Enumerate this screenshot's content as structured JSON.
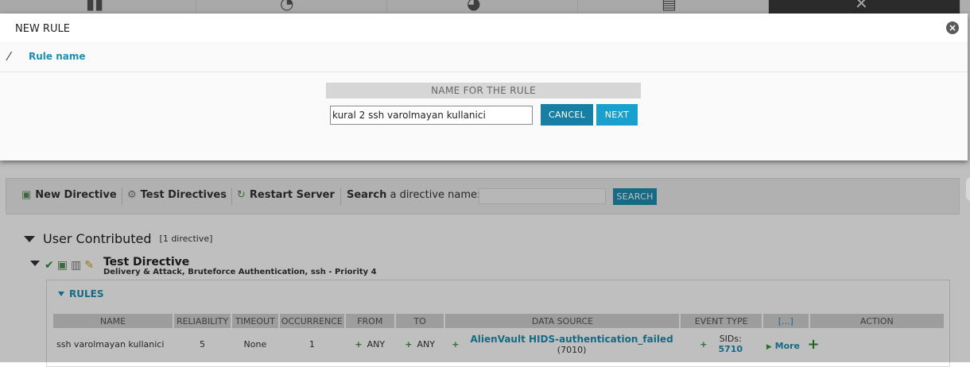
{
  "nav": {
    "tabs": [
      {
        "icon": "bar-chart-icon"
      },
      {
        "icon": "analysis-icon"
      },
      {
        "icon": "globe-icon"
      },
      {
        "icon": "report-icon"
      },
      {
        "icon": "tools-icon"
      }
    ]
  },
  "modal": {
    "title": "NEW RULE",
    "close_icon": "close-icon",
    "step_label": "Rule name",
    "form_header": "NAME FOR THE RULE",
    "rule_name_value": "kural 2 ssh varolmayan kullanici",
    "cancel_label": "CANCEL",
    "next_label": "NEXT"
  },
  "toolbar": {
    "new_directive": "New Directive",
    "test_directives": "Test Directives",
    "restart_server": "Restart Server",
    "search_bold": "Search",
    "search_rest": "a directive name:",
    "search_button": "SEARCH"
  },
  "group": {
    "title": "User Contributed",
    "count": "[1 directive]"
  },
  "directive": {
    "name": "Test Directive",
    "description": "Delivery & Attack, Bruteforce Authentication, ssh - Priority 4"
  },
  "rules": {
    "title": "RULES",
    "headers": [
      "NAME",
      "RELIABILITY",
      "TIMEOUT",
      "OCCURRENCE",
      "FROM",
      "TO",
      "DATA SOURCE",
      "EVENT TYPE",
      "[...]",
      "ACTION"
    ],
    "row": {
      "name": "ssh varolmayan kullanici",
      "reliability": "5",
      "timeout": "None",
      "occurrence": "1",
      "from": "ANY",
      "to": "ANY",
      "data_source": "AlienVault HIDS-authentication_failed",
      "data_source_id": "(7010)",
      "sids_label": "SIDs:",
      "sids_value": "5710",
      "more": "More"
    }
  },
  "colors": {
    "accent": "#1c8fb3",
    "cancel_button": "#167fa3",
    "next_button": "#1aa0cc",
    "plus_green": "#3a9a3a"
  }
}
